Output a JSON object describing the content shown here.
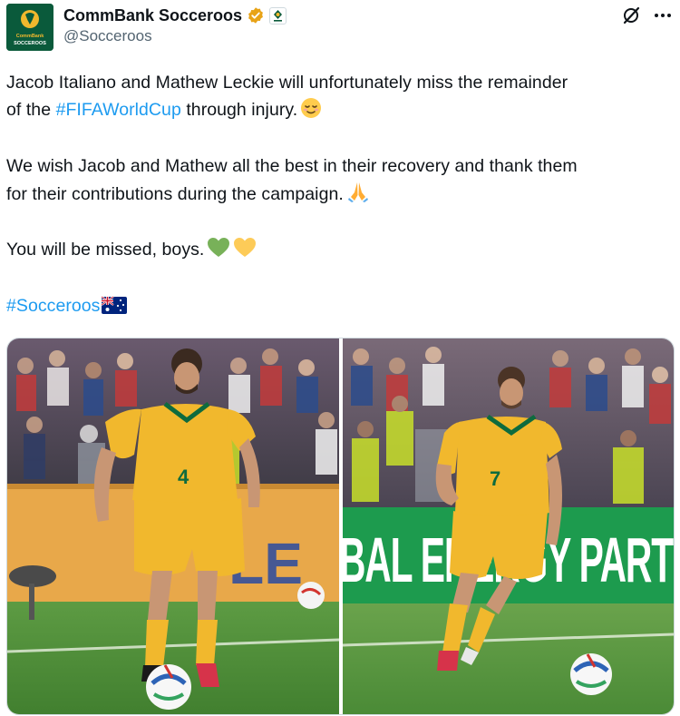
{
  "author": {
    "display_name": "CommBank Socceroos",
    "handle": "@Socceroos",
    "avatar_text_top": "CommBank",
    "avatar_text_bottom": "SOCCEROOS",
    "verified_color": "#e8a317"
  },
  "tweet": {
    "line1": "Jacob Italiano and Mathew Leckie will unfortunately miss the remainder",
    "line2_before": "of the ",
    "line2_hashtag": "#FIFAWorldCup",
    "line2_after": " through injury.",
    "line3": "We wish Jacob and Mathew all the best in their recovery and thank them",
    "line4": "for their contributions during the campaign.",
    "line5": "You will be missed, boys.",
    "hashtag": "#Socceroos"
  },
  "icons": {
    "grok": "grok-icon",
    "more": "more-options-icon",
    "verified": "verified-badge-icon",
    "affiliate": "affiliate-badge-icon",
    "emoji_relieved": "relieved-face-emoji",
    "emoji_pray": "folded-hands-emoji",
    "emoji_green_heart": "green-heart-emoji",
    "emoji_yellow_heart": "yellow-heart-emoji",
    "emoji_flag": "australia-flag-emoji"
  },
  "photos": {
    "left": {
      "description_icon": "player-photo",
      "shirt_number": "4"
    },
    "right": {
      "description_icon": "player-photo",
      "shirt_number": "7",
      "board_text": "BAL ENERGY PART"
    }
  },
  "colors": {
    "text": "#0f1419",
    "secondary": "#536471",
    "link": "#1d9bf0",
    "kit_gold": "#f1b82d",
    "kit_green": "#0e6b3e",
    "pitch": "#4f8f3a"
  }
}
